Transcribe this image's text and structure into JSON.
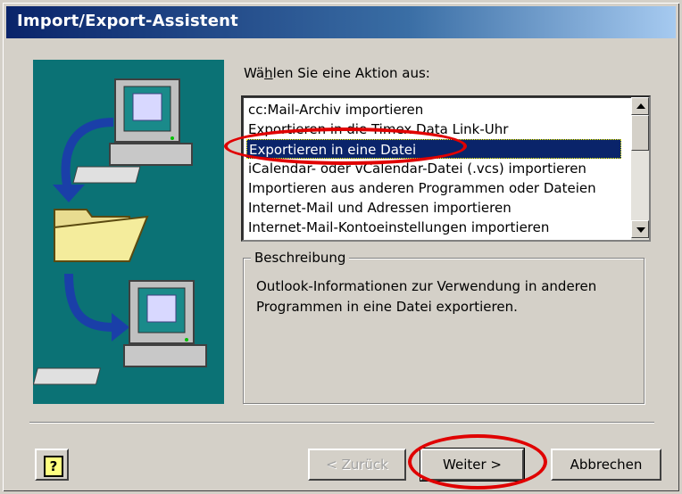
{
  "window": {
    "title": "Import/Export-Assistent"
  },
  "actions_label": "Wählen Sie eine Aktion aus:",
  "actions_label_parts": {
    "before": "Wä",
    "mnemonic": "h",
    "after": "len Sie eine Aktion aus:"
  },
  "action_list": {
    "items": [
      "cc:Mail-Archiv importieren",
      "Exportieren in die Timex Data Link-Uhr",
      "Exportieren in eine Datei",
      "iCalendar- oder vCalendar-Datei (.vcs) importieren",
      "Importieren aus anderen Programmen oder Dateien",
      "Internet-Mail und Adressen importieren",
      "Internet-Mail-Kontoeinstellungen importieren"
    ],
    "selected_index": 2
  },
  "description": {
    "legend": "Beschreibung",
    "text": "Outlook-Informationen zur Verwendung in anderen Programmen in eine Datei exportieren."
  },
  "buttons": {
    "help": "?",
    "back": "< Zurück",
    "next": "Weiter >",
    "cancel": "Abbrechen"
  },
  "colors": {
    "title_gradient_start": "#0a246a",
    "panel_bg": "#0b7275",
    "selection": "#0a246a",
    "annotation": "#e00000"
  }
}
